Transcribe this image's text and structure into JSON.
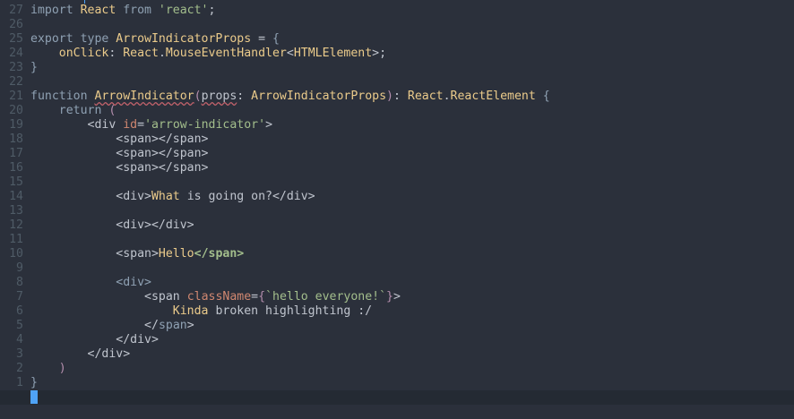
{
  "editor": {
    "lines": [
      {
        "num": "27",
        "tokens": [
          [
            "kw2",
            "import "
          ],
          [
            "type",
            "React"
          ],
          [
            "kw2",
            " from "
          ],
          [
            "str",
            "'react'"
          ],
          [
            "punc",
            ";"
          ]
        ]
      },
      {
        "num": "26",
        "tokens": []
      },
      {
        "num": "25",
        "tokens": [
          [
            "kw2",
            "export type "
          ],
          [
            "type",
            "ArrowIndicatorProps"
          ],
          [
            "punc",
            " = "
          ],
          [
            "brace",
            "{"
          ]
        ]
      },
      {
        "num": "24",
        "tokens": [
          [
            "punc",
            "    "
          ],
          [
            "type",
            "onClick"
          ],
          [
            "punc",
            ": "
          ],
          [
            "type",
            "React"
          ],
          [
            "punc",
            "."
          ],
          [
            "type",
            "MouseEventHandler"
          ],
          [
            "punc",
            "<"
          ],
          [
            "type",
            "HTMLElement"
          ],
          [
            "punc",
            ">;"
          ]
        ]
      },
      {
        "num": "23",
        "tokens": [
          [
            "brace",
            "}"
          ]
        ]
      },
      {
        "num": "22",
        "tokens": []
      },
      {
        "num": "21",
        "tokens": [
          [
            "kw2",
            "function "
          ],
          [
            "fn-err",
            "ArrowIndicator"
          ],
          [
            "paren",
            "("
          ],
          [
            "err",
            "props"
          ],
          [
            "punc",
            ": "
          ],
          [
            "type",
            "ArrowIndicatorProps"
          ],
          [
            "paren",
            ")"
          ],
          [
            "punc",
            ": "
          ],
          [
            "type",
            "React"
          ],
          [
            "punc",
            "."
          ],
          [
            "type",
            "ReactElement"
          ],
          [
            "brace",
            " {"
          ]
        ]
      },
      {
        "num": "20",
        "tokens": [
          [
            "punc",
            "    "
          ],
          [
            "kw2",
            "return "
          ],
          [
            "paren",
            "("
          ]
        ]
      },
      {
        "num": "19",
        "tokens": [
          [
            "punc",
            "        "
          ],
          [
            "tag",
            "<div "
          ],
          [
            "attr",
            "id"
          ],
          [
            "punc",
            "="
          ],
          [
            "str",
            "'arrow-indicator'"
          ],
          [
            "tag",
            ">"
          ]
        ]
      },
      {
        "num": "18",
        "tokens": [
          [
            "punc",
            "            "
          ],
          [
            "tag",
            "<span></span>"
          ]
        ]
      },
      {
        "num": "17",
        "tokens": [
          [
            "punc",
            "            "
          ],
          [
            "tag",
            "<span></span>"
          ]
        ]
      },
      {
        "num": "16",
        "tokens": [
          [
            "punc",
            "            "
          ],
          [
            "tag",
            "<span></span>"
          ]
        ]
      },
      {
        "num": "15",
        "tokens": []
      },
      {
        "num": "14",
        "tokens": [
          [
            "punc",
            "            "
          ],
          [
            "tag",
            "<div>"
          ],
          [
            "text",
            "What "
          ],
          [
            "punc",
            "is going on?"
          ],
          [
            "tag",
            "</div>"
          ]
        ]
      },
      {
        "num": "13",
        "tokens": []
      },
      {
        "num": "12",
        "tokens": [
          [
            "punc",
            "            "
          ],
          [
            "tag",
            "<div></div>"
          ]
        ]
      },
      {
        "num": "11",
        "tokens": []
      },
      {
        "num": "10",
        "tokens": [
          [
            "punc",
            "            "
          ],
          [
            "tag",
            "<span>"
          ],
          [
            "text",
            "Hello"
          ],
          [
            "boldgreen",
            "</span>"
          ]
        ]
      },
      {
        "num": "9",
        "tokens": []
      },
      {
        "num": "8",
        "tokens": [
          [
            "punc",
            "            "
          ],
          [
            "kw2",
            "<div>"
          ]
        ]
      },
      {
        "num": "7",
        "tokens": [
          [
            "punc",
            "                "
          ],
          [
            "tag",
            "<span "
          ],
          [
            "attr",
            "className"
          ],
          [
            "punc",
            "="
          ],
          [
            "kw",
            "{"
          ],
          [
            "str",
            "`hello everyone!`"
          ],
          [
            "kw",
            "}"
          ],
          [
            "tag",
            ">"
          ]
        ]
      },
      {
        "num": "6",
        "tokens": [
          [
            "punc",
            "                    "
          ],
          [
            "text",
            "Kinda "
          ],
          [
            "punc",
            "broken highlighting :/"
          ]
        ]
      },
      {
        "num": "5",
        "tokens": [
          [
            "punc",
            "                "
          ],
          [
            "tag",
            "</"
          ],
          [
            "kw2",
            "span"
          ],
          [
            "tag",
            ">"
          ]
        ]
      },
      {
        "num": "4",
        "tokens": [
          [
            "punc",
            "            "
          ],
          [
            "tag",
            "</div>"
          ]
        ]
      },
      {
        "num": "3",
        "tokens": [
          [
            "punc",
            "        "
          ],
          [
            "tag",
            "</div>"
          ]
        ]
      },
      {
        "num": "2",
        "tokens": [
          [
            "punc",
            "    "
          ],
          [
            "paren",
            ")"
          ]
        ]
      },
      {
        "num": "1",
        "tokens": [
          [
            "brace",
            "}"
          ]
        ]
      },
      {
        "num": "",
        "tokens": [],
        "cursor": true
      }
    ]
  }
}
